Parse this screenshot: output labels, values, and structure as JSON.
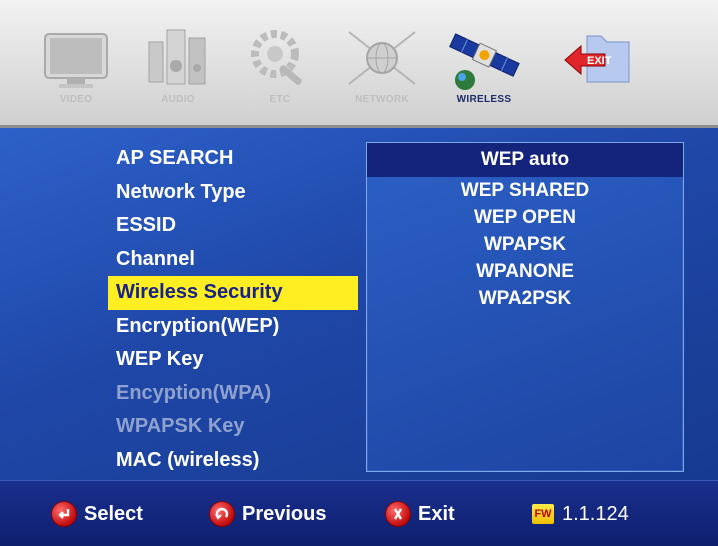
{
  "tabs": [
    {
      "label": "VIDEO",
      "icon": "tv-icon",
      "active": false
    },
    {
      "label": "AUDIO",
      "icon": "speakers-icon",
      "active": false
    },
    {
      "label": "ETC",
      "icon": "tools-icon",
      "active": false
    },
    {
      "label": "NETWORK",
      "icon": "network-globe-icon",
      "active": false
    },
    {
      "label": "WIRELESS",
      "icon": "satellite-icon",
      "active": true
    },
    {
      "label": "EXIT",
      "icon": "exit-folder-icon",
      "active": false
    }
  ],
  "menu": [
    {
      "label": "AP SEARCH",
      "state": "normal"
    },
    {
      "label": "Network Type",
      "state": "normal"
    },
    {
      "label": "ESSID",
      "state": "normal"
    },
    {
      "label": "Channel",
      "state": "normal"
    },
    {
      "label": "Wireless Security",
      "state": "selected"
    },
    {
      "label": "Encryption(WEP)",
      "state": "normal"
    },
    {
      "label": "WEP Key",
      "state": "normal"
    },
    {
      "label": "Encyption(WPA)",
      "state": "disabled"
    },
    {
      "label": "WPAPSK Key",
      "state": "disabled"
    },
    {
      "label": "MAC (wireless)",
      "state": "normal"
    }
  ],
  "options": [
    {
      "label": "WEP auto",
      "selected": true
    },
    {
      "label": "WEP SHARED",
      "selected": false
    },
    {
      "label": "WEP OPEN",
      "selected": false
    },
    {
      "label": "WPAPSK",
      "selected": false
    },
    {
      "label": "WPANONE",
      "selected": false
    },
    {
      "label": "WPA2PSK",
      "selected": false
    }
  ],
  "footer": {
    "select_label": "Select",
    "previous_label": "Previous",
    "exit_label": "Exit",
    "fw_badge": "FW",
    "version": "1.1.124"
  },
  "colors": {
    "selection_highlight": "#ffee22",
    "panel_selection": "#14237c",
    "background": "#1f47a8"
  }
}
